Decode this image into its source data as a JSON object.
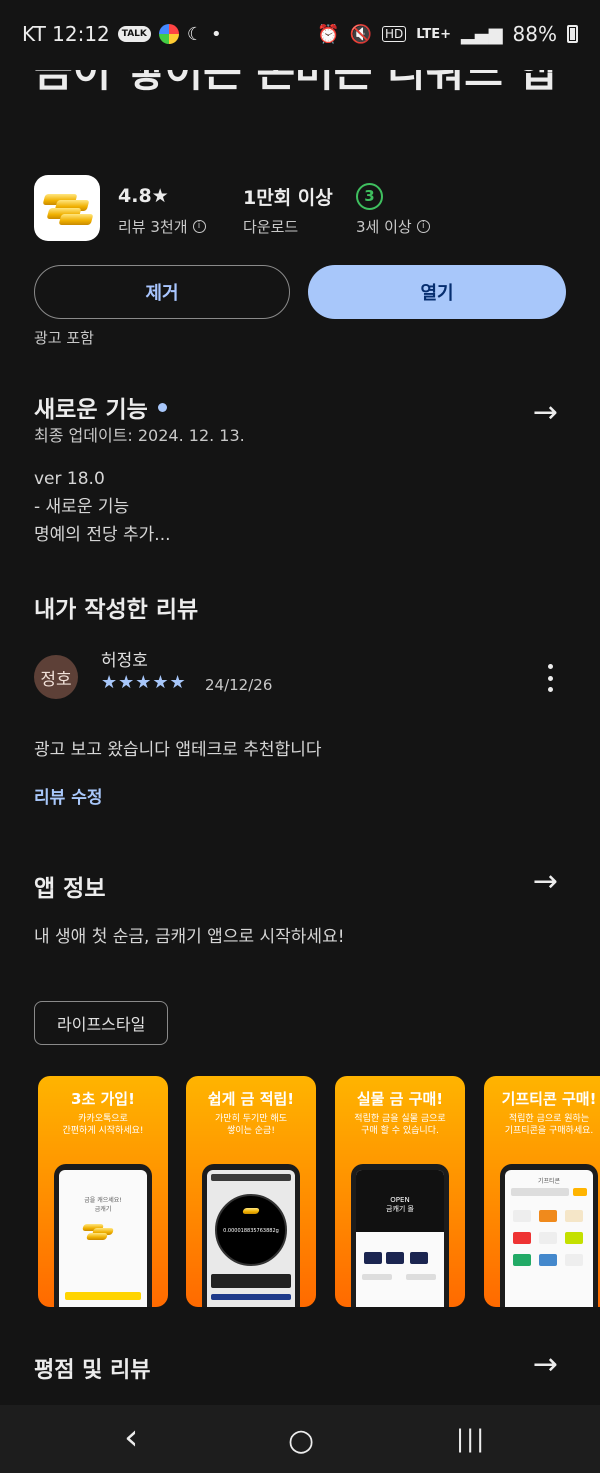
{
  "status_bar": {
    "carrier_time": "KT 12:12",
    "talk_badge": "TALK",
    "network": "LTE+",
    "battery": "88%",
    "icons": [
      "chat-icon",
      "color-app-icon",
      "moon-icon",
      "alarm-icon",
      "mute-icon",
      "hd-icon",
      "signal-icon",
      "battery-icon"
    ]
  },
  "app": {
    "title": "금이 쌓이는 돈버는 리워드 앱",
    "icon": "gold-bars-icon",
    "rating": "4.8★",
    "reviews_label": "리뷰 3천개",
    "downloads": "1만회 이상",
    "downloads_label": "다운로드",
    "age_rating": "3",
    "age_label": "3세 이상"
  },
  "actions": {
    "remove": "제거",
    "open": "열기",
    "ads_note": "광고 포함"
  },
  "whats_new": {
    "title": "새로운 기능",
    "updated": "최종 업데이트: 2024. 12. 13.",
    "lines": [
      "ver 18.0",
      "- 새로운 기능",
      "명예의 전당 추가..."
    ]
  },
  "my_review": {
    "title": "내가 작성한 리뷰",
    "avatar_text": "정호",
    "reviewer": "허정호",
    "stars": "★★★★★",
    "date": "24/12/26",
    "text": "광고 보고 왔습니다 앱테크로 추천합니다",
    "edit_label": "리뷰 수정"
  },
  "about": {
    "title": "앱 정보",
    "description": "내 생애 첫 순금, 금캐기 앱으로 시작하세요!",
    "category": "라이프스타일"
  },
  "screenshots": [
    {
      "headline": "3초 가입!",
      "sub": "카카오톡으로\n간편하게 시작하세요!",
      "screen_text": "금을 캐으세요!\n금캐기"
    },
    {
      "headline": "쉽게 금 적립!",
      "sub": "가만히 두기만 해도\n쌓이는 순금!",
      "screen_text": "0.000018835763882g"
    },
    {
      "headline": "실물 금 구매!",
      "sub": "적립한 금을 실물 금으로\n구매 할 수 있습니다.",
      "screen_text": "OPEN\n금캐기 몰"
    },
    {
      "headline": "기프티콘 구매!",
      "sub": "적립한 금으로 원하는\n기프티콘을 구매하세요.",
      "screen_text": "기프티콘"
    }
  ],
  "ratings": {
    "title": "평점 및 리뷰"
  },
  "nav": {
    "back": "‹",
    "home": "○",
    "recents": "|||"
  }
}
